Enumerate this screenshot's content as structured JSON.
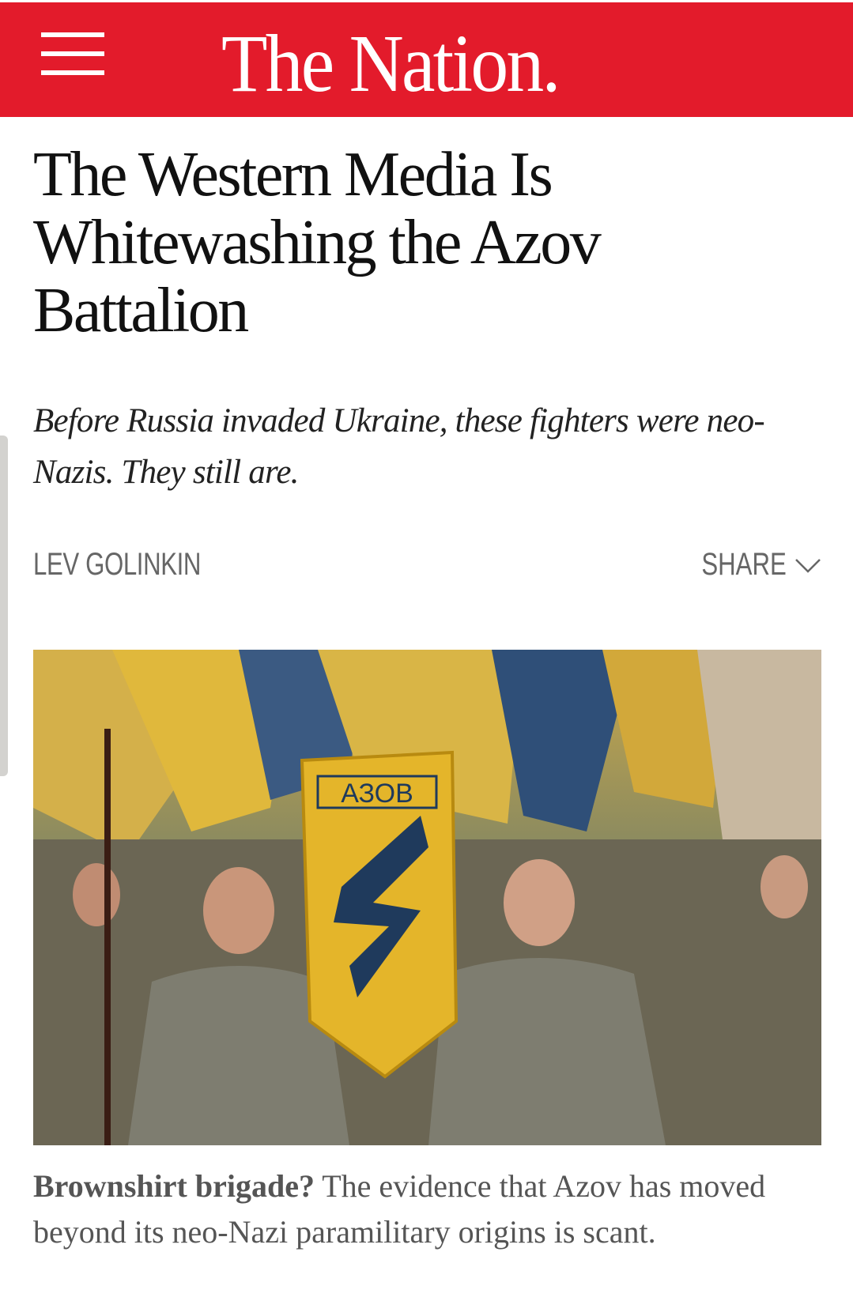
{
  "header": {
    "logo": "The Nation.",
    "menu_icon": "hamburger-icon",
    "brand_color": "#e31b2b"
  },
  "article": {
    "title": "The Western Media Is Whitewashing the Azov Battalion",
    "deck": "Before Russia invaded Ukraine, these fighters were neo-Nazis. They still are.",
    "author": "LEV GOLINKIN",
    "share_label": "SHARE",
    "share_icon": "chevron-down-icon",
    "image_patch_text": "АЗОВ",
    "caption_bold": "Brownshirt brigade?",
    "caption_text": " The evidence that Azov has moved beyond its neo-Nazi paramilitary origins is scant."
  }
}
